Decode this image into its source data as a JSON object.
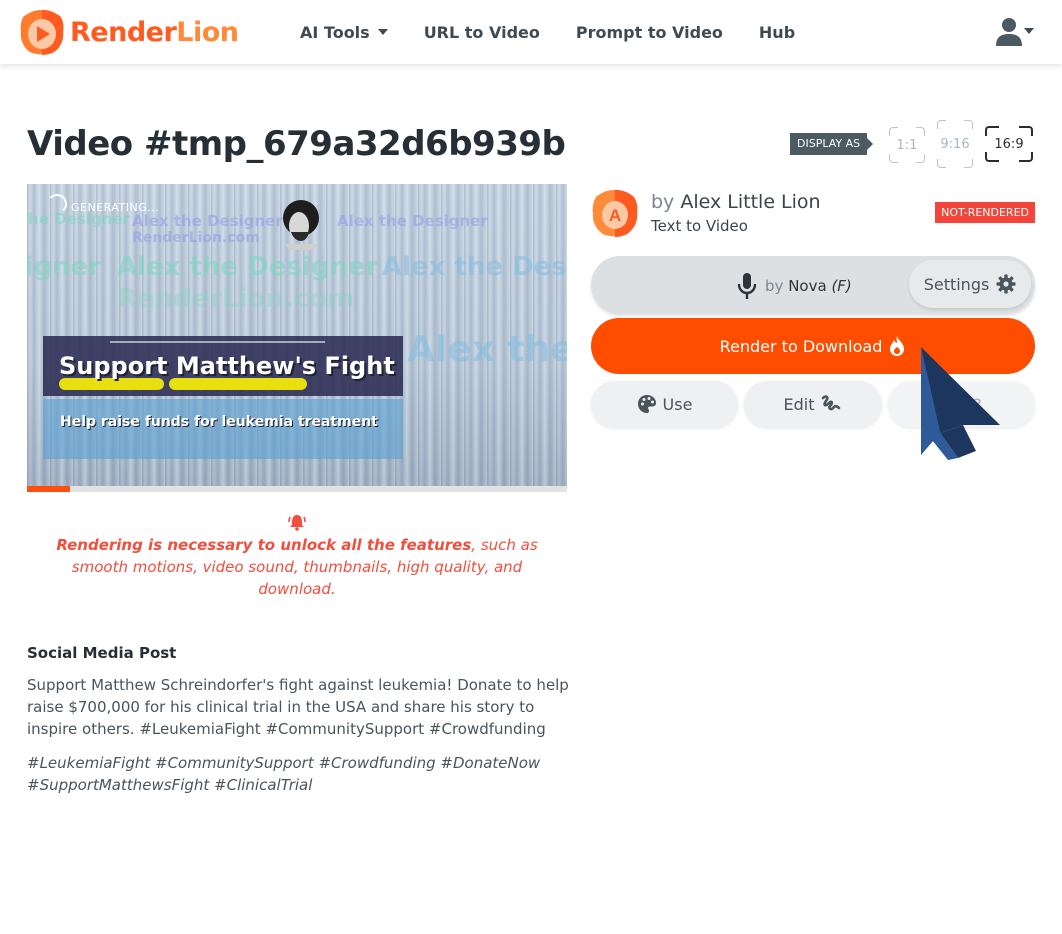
{
  "navbar": {
    "logo": {
      "render": "Render",
      "lion": "Lion"
    },
    "links": [
      {
        "label": "AI Tools",
        "has_dropdown": true
      },
      {
        "label": "URL to Video"
      },
      {
        "label": "Prompt to Video"
      },
      {
        "label": "Hub"
      }
    ],
    "user_icon": "user-icon"
  },
  "page": {
    "title": "Video #tmp_679a32d6b939b",
    "display_as": {
      "label": "DISPLAY AS",
      "options": [
        "1:1",
        "9:16",
        "16:9"
      ],
      "selected": "16:9"
    }
  },
  "video": {
    "status": "GENERATING...",
    "watermarks": [
      "Alex the Designer",
      "RenderLion.com"
    ],
    "headline": "Support Matthew's Fight",
    "subheadline": "Help raise funds for leukemia treatment",
    "progress_percent": 8
  },
  "notice": {
    "icon": "bell-icon",
    "bold": "Rendering is necessary to unlock all the features",
    "rest": ", such as smooth motions, video sound, thumbnails, high quality, and download."
  },
  "social": {
    "heading": "Social Media Post",
    "body": "Support Matthew Schreindorfer's fight against leukemia! Donate to help raise $700,000 for his clinical trial in the USA and share his story to inspire others. #LeukemiaFight #CommunitySupport #Crowdfunding",
    "tags": "#LeukemiaFight #CommunitySupport #Crowdfunding #DonateNow #SupportMatthewsFight #ClinicalTrial"
  },
  "author": {
    "initial": "A",
    "by": "by",
    "name": "Alex Little Lion",
    "type": "Text to Video",
    "badge": "NOT-RENDERED"
  },
  "voice": {
    "by": "by",
    "name": "Nova",
    "gender": "(F)",
    "settings_label": "Settings"
  },
  "actions": {
    "render_label": "Render to Download",
    "use_label": "Use",
    "edit_label": "Edit",
    "third_label": "Like?"
  },
  "colors": {
    "brand_orange": "#ff4d00",
    "badge_red": "#f2453b",
    "notice_red": "#f24e3e"
  }
}
